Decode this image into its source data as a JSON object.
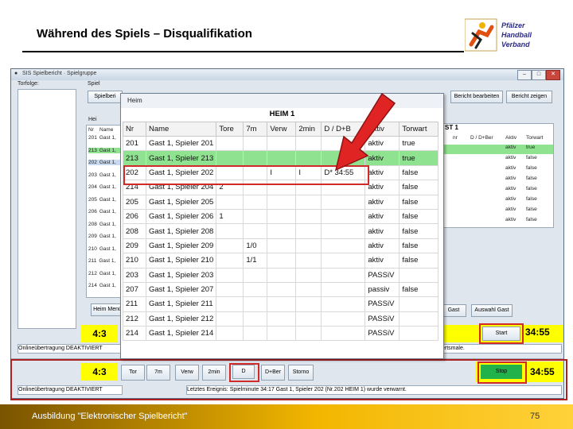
{
  "slide": {
    "title": "Während des Spiels – Disqualifikation",
    "logo_lines": [
      "Pfälzer",
      "Handball",
      "Verband"
    ],
    "footer_text": "Ausbildung \"Elektronischer Spielbericht\"",
    "page_number": "75"
  },
  "window": {
    "title": "SIS Spielbericht · Spielgruppe",
    "buttons": [
      "–",
      "□",
      "✕"
    ]
  },
  "toolbar": {
    "torfolge_label": "Torfolge:",
    "spiel_label": "Spiel",
    "spiel_tab": "Spielberi",
    "bericht_bearbeiten": "Bericht bearbeiten",
    "bericht_zeigen": "Bericht zeigen"
  },
  "left_panel": {
    "header_label": "Hei",
    "small_headers": [
      "Nr",
      "Name"
    ],
    "rows": [
      {
        "nr": "201",
        "name": "Gast 1,"
      },
      {
        "nr": "213",
        "name": "Gast 1,"
      },
      {
        "nr": "202",
        "name": "Gast 1,"
      },
      {
        "nr": "203",
        "name": "Gast 1,"
      },
      {
        "nr": "204",
        "name": "Gast 1,"
      },
      {
        "nr": "205",
        "name": "Gast 1,"
      },
      {
        "nr": "206",
        "name": "Gast 1,"
      },
      {
        "nr": "208",
        "name": "Gast 1,"
      },
      {
        "nr": "209",
        "name": "Gast 1,"
      },
      {
        "nr": "210",
        "name": "Gast 1,"
      },
      {
        "nr": "211",
        "name": "Gast 1,"
      },
      {
        "nr": "212",
        "name": "Gast 1,"
      },
      {
        "nr": "214",
        "name": "Gast 1,"
      }
    ],
    "heim_menu_btn": "Heim Menü"
  },
  "right_panel": {
    "header_title": "ST 1",
    "headers": [
      "nr",
      "D / D+Ber",
      "Aktiv",
      "Torwart"
    ],
    "rows": [
      {
        "aktiv": "aktiv",
        "torwart": "true"
      },
      {
        "aktiv": "aktiv",
        "torwart": "false"
      },
      {
        "aktiv": "aktiv",
        "torwart": "false"
      },
      {
        "aktiv": "aktiv",
        "torwart": "false"
      },
      {
        "aktiv": "aktiv",
        "torwart": "false"
      },
      {
        "aktiv": "aktiv",
        "torwart": "false"
      },
      {
        "aktiv": "aktiv",
        "torwart": "false"
      },
      {
        "aktiv": "aktiv",
        "torwart": "false"
      }
    ],
    "gast_btn": "Gast",
    "auswahl_gast_btn": "Auswahl Gast"
  },
  "popup": {
    "tab_label": "Heim",
    "team_title": "HEIM 1",
    "columns": [
      "Nr",
      "Name",
      "Tore",
      "7m",
      "Verw",
      "2min",
      "D / D+B",
      "Aktiv",
      "Torwart"
    ],
    "rows": [
      {
        "nr": "201",
        "name": "Gast 1, Spieler 201",
        "tore": "",
        "m7": "",
        "verw": "",
        "min2": "",
        "d": "",
        "aktiv": "aktiv",
        "torwart": "true"
      },
      {
        "nr": "213",
        "name": "Gast 1, Spieler 213",
        "tore": "",
        "m7": "",
        "verw": "",
        "min2": "",
        "d": "",
        "aktiv": "aktiv",
        "torwart": "true"
      },
      {
        "nr": "202",
        "name": "Gast 1, Spieler 202",
        "tore": "",
        "m7": "",
        "verw": "I",
        "min2": "I",
        "d": "D* 34:55",
        "aktiv": "aktiv",
        "torwart": "false"
      },
      {
        "nr": "214",
        "name": "Gast 1, Spieler 204",
        "tore": "2",
        "m7": "",
        "verw": "",
        "min2": "",
        "d": "",
        "aktiv": "aktiv",
        "torwart": "false"
      },
      {
        "nr": "205",
        "name": "Gast 1, Spieler 205",
        "tore": "",
        "m7": "",
        "verw": "",
        "min2": "",
        "d": "",
        "aktiv": "aktiv",
        "torwart": "false"
      },
      {
        "nr": "206",
        "name": "Gast 1, Spieler 206",
        "tore": "1",
        "m7": "",
        "verw": "",
        "min2": "",
        "d": "",
        "aktiv": "aktiv",
        "torwart": "false"
      },
      {
        "nr": "208",
        "name": "Gast 1, Spieler 208",
        "tore": "",
        "m7": "",
        "verw": "",
        "min2": "",
        "d": "",
        "aktiv": "aktiv",
        "torwart": "false"
      },
      {
        "nr": "209",
        "name": "Gast 1, Spieler 209",
        "tore": "",
        "m7": "1/0",
        "verw": "",
        "min2": "",
        "d": "",
        "aktiv": "aktiv",
        "torwart": "false"
      },
      {
        "nr": "210",
        "name": "Gast 1, Spieler 210",
        "tore": "",
        "m7": "1/1",
        "verw": "",
        "min2": "",
        "d": "",
        "aktiv": "aktiv",
        "torwart": "false"
      },
      {
        "nr": "203",
        "name": "Gast 1, Spieler 203",
        "tore": "",
        "m7": "",
        "verw": "",
        "min2": "",
        "d": "",
        "aktiv": "PASSiV",
        "torwart": ""
      },
      {
        "nr": "207",
        "name": "Gast 1, Spieler 207",
        "tore": "",
        "m7": "",
        "verw": "",
        "min2": "",
        "d": "",
        "aktiv": "passiv",
        "torwart": "false"
      },
      {
        "nr": "211",
        "name": "Gast 1, Spieler 211",
        "tore": "",
        "m7": "",
        "verw": "",
        "min2": "",
        "d": "",
        "aktiv": "PASSiV",
        "torwart": ""
      },
      {
        "nr": "212",
        "name": "Gast 1, Spieler 212",
        "tore": "",
        "m7": "",
        "verw": "",
        "min2": "",
        "d": "",
        "aktiv": "PASSiV",
        "torwart": ""
      },
      {
        "nr": "214",
        "name": "Gast 1, Spieler 214",
        "tore": "",
        "m7": "",
        "verw": "",
        "min2": "",
        "d": "",
        "aktiv": "PASSiV",
        "torwart": ""
      }
    ]
  },
  "score_top": {
    "score": "4:3",
    "start_btn": "Start",
    "time": "34:55",
    "online_status": "Onlineübertragung DEAKTIVIERT",
    "status_tail": "ertsmale."
  },
  "score_bottom": {
    "score": "4:3",
    "buttons": [
      "Tor",
      "7m",
      "Verw",
      "2min",
      "D",
      "D+Ber",
      "Storno"
    ],
    "stop_btn": "Stop",
    "time": "34:55",
    "online_status": "Onlineübertragung DEAKTIVIERT",
    "last_event": "Letztes Ereignis: Spielminute 34:17 Gast 1, Spieler 202 (Nr.202 HEIM 1) wurde verwarnt."
  },
  "colors": {
    "selection_green": "#8fe28f",
    "score_yellow": "#ffff00",
    "highlight_red": "#d12a2a",
    "stop_green": "#22b24c",
    "footer_gold": "#f2b600"
  }
}
